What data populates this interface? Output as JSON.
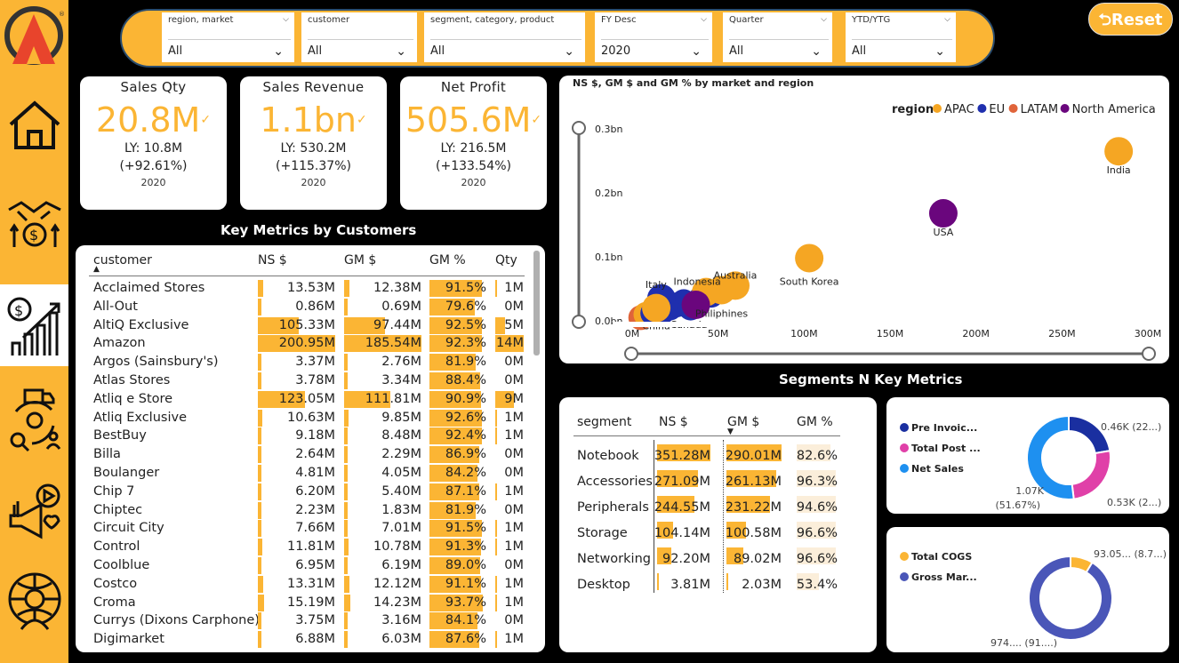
{
  "filters": [
    {
      "label": "region, market",
      "value": "All"
    },
    {
      "label": "customer",
      "value": "All"
    },
    {
      "label": "segment, category, product",
      "value": "All"
    },
    {
      "label": "FY Desc",
      "value": "2020"
    },
    {
      "label": "Quarter",
      "value": "All"
    },
    {
      "label": "YTD/YTG",
      "value": "All"
    }
  ],
  "reset_label": "Reset",
  "kpis": [
    {
      "title": "Sales Qty",
      "value": "20.8M",
      "ly": "LY: 10.8M",
      "pct": "(+92.61%)",
      "year": "2020"
    },
    {
      "title": "Sales Revenue",
      "value": "1.1bn",
      "ly": "LY: 530.2M",
      "pct": "(+115.37%)",
      "year": "2020"
    },
    {
      "title": "Net Profit",
      "value": "505.6M",
      "ly": "LY: 216.5M",
      "pct": "(+133.54%)",
      "year": "2020"
    }
  ],
  "customers_title": "Key Metrics by Customers",
  "customers_headers": {
    "customer": "customer",
    "ns": "NS $",
    "gm": "GM $",
    "gmp": "GM %",
    "qty": "Qty"
  },
  "customers": [
    {
      "name": "Acclaimed Stores",
      "ns": "13.53M",
      "gm": "12.38M",
      "gmp": "91.5%",
      "qty": "1M",
      "nsv": 13.53,
      "gmv": 12.38,
      "gmpv": 91.5,
      "qtyv": 1
    },
    {
      "name": "All-Out",
      "ns": "0.86M",
      "gm": "0.69M",
      "gmp": "79.6%",
      "qty": "0M",
      "nsv": 0.86,
      "gmv": 0.69,
      "gmpv": 79.6,
      "qtyv": 0
    },
    {
      "name": "AltiQ Exclusive",
      "ns": "105.33M",
      "gm": "97.44M",
      "gmp": "92.5%",
      "qty": "5M",
      "nsv": 105.33,
      "gmv": 97.44,
      "gmpv": 92.5,
      "qtyv": 5
    },
    {
      "name": "Amazon",
      "ns": "200.95M",
      "gm": "185.54M",
      "gmp": "92.3%",
      "qty": "14M",
      "nsv": 200.95,
      "gmv": 185.54,
      "gmpv": 92.3,
      "qtyv": 14
    },
    {
      "name": "Argos (Sainsbury's)",
      "ns": "3.37M",
      "gm": "2.76M",
      "gmp": "81.9%",
      "qty": "0M",
      "nsv": 3.37,
      "gmv": 2.76,
      "gmpv": 81.9,
      "qtyv": 0
    },
    {
      "name": "Atlas Stores",
      "ns": "3.78M",
      "gm": "3.34M",
      "gmp": "88.4%",
      "qty": "0M",
      "nsv": 3.78,
      "gmv": 3.34,
      "gmpv": 88.4,
      "qtyv": 0
    },
    {
      "name": "Atliq e Store",
      "ns": "123.05M",
      "gm": "111.81M",
      "gmp": "90.9%",
      "qty": "9M",
      "nsv": 123.05,
      "gmv": 111.81,
      "gmpv": 90.9,
      "qtyv": 9
    },
    {
      "name": "Atliq Exclusive",
      "ns": "10.63M",
      "gm": "9.85M",
      "gmp": "92.6%",
      "qty": "1M",
      "nsv": 10.63,
      "gmv": 9.85,
      "gmpv": 92.6,
      "qtyv": 1
    },
    {
      "name": "BestBuy",
      "ns": "9.18M",
      "gm": "8.48M",
      "gmp": "92.4%",
      "qty": "1M",
      "nsv": 9.18,
      "gmv": 8.48,
      "gmpv": 92.4,
      "qtyv": 1
    },
    {
      "name": "Billa",
      "ns": "2.64M",
      "gm": "2.29M",
      "gmp": "86.9%",
      "qty": "0M",
      "nsv": 2.64,
      "gmv": 2.29,
      "gmpv": 86.9,
      "qtyv": 0
    },
    {
      "name": "Boulanger",
      "ns": "4.81M",
      "gm": "4.05M",
      "gmp": "84.2%",
      "qty": "0M",
      "nsv": 4.81,
      "gmv": 4.05,
      "gmpv": 84.2,
      "qtyv": 0
    },
    {
      "name": "Chip 7",
      "ns": "6.20M",
      "gm": "5.40M",
      "gmp": "87.1%",
      "qty": "1M",
      "nsv": 6.2,
      "gmv": 5.4,
      "gmpv": 87.1,
      "qtyv": 1
    },
    {
      "name": "Chiptec",
      "ns": "2.23M",
      "gm": "1.83M",
      "gmp": "81.9%",
      "qty": "0M",
      "nsv": 2.23,
      "gmv": 1.83,
      "gmpv": 81.9,
      "qtyv": 0
    },
    {
      "name": "Circuit City",
      "ns": "7.66M",
      "gm": "7.01M",
      "gmp": "91.5%",
      "qty": "1M",
      "nsv": 7.66,
      "gmv": 7.01,
      "gmpv": 91.5,
      "qtyv": 1
    },
    {
      "name": "Control",
      "ns": "11.81M",
      "gm": "10.78M",
      "gmp": "91.3%",
      "qty": "1M",
      "nsv": 11.81,
      "gmv": 10.78,
      "gmpv": 91.3,
      "qtyv": 1
    },
    {
      "name": "Coolblue",
      "ns": "6.95M",
      "gm": "6.19M",
      "gmp": "89.0%",
      "qty": "0M",
      "nsv": 6.95,
      "gmv": 6.19,
      "gmpv": 89.0,
      "qtyv": 0
    },
    {
      "name": "Costco",
      "ns": "13.31M",
      "gm": "12.12M",
      "gmp": "91.1%",
      "qty": "1M",
      "nsv": 13.31,
      "gmv": 12.12,
      "gmpv": 91.1,
      "qtyv": 1
    },
    {
      "name": "Croma",
      "ns": "15.19M",
      "gm": "14.23M",
      "gmp": "93.7%",
      "qty": "1M",
      "nsv": 15.19,
      "gmv": 14.23,
      "gmpv": 93.7,
      "qtyv": 1
    },
    {
      "name": "Currys (Dixons Carphone)",
      "ns": "3.75M",
      "gm": "3.16M",
      "gmp": "84.1%",
      "qty": "0M",
      "nsv": 3.75,
      "gmv": 3.16,
      "gmpv": 84.1,
      "qtyv": 0
    },
    {
      "name": "Digimarket",
      "ns": "6.88M",
      "gm": "6.03M",
      "gmp": "87.6%",
      "qty": "1M",
      "nsv": 6.88,
      "gmv": 6.03,
      "gmpv": 87.6,
      "qtyv": 1
    }
  ],
  "scatter_title": "NS $, GM $ and GM % by market and region",
  "scatter_legend_title": "region",
  "chart_data": {
    "type": "scatter",
    "title": "NS $, GM $ and GM % by market and region",
    "xlim": [
      0,
      300
    ],
    "ylim": [
      0,
      0.3
    ],
    "x_ticks": [
      "0M",
      "50M",
      "100M",
      "150M",
      "200M",
      "250M",
      "300M"
    ],
    "y_ticks": [
      "0.0bn",
      "0.1bn",
      "0.2bn",
      "0.3bn"
    ],
    "legend": [
      {
        "name": "APAC",
        "color": "#f5a623"
      },
      {
        "name": "EU",
        "color": "#1f2fae"
      },
      {
        "name": "LATAM",
        "color": "#e0643a"
      },
      {
        "name": "North America",
        "color": "#6a067d"
      }
    ],
    "points": [
      {
        "label": "India",
        "x": 283,
        "y": 0.265,
        "region": "APAC"
      },
      {
        "label": "USA",
        "x": 181,
        "y": 0.168,
        "region": "North America"
      },
      {
        "label": "South Korea",
        "x": 103,
        "y": 0.098,
        "region": "APAC"
      },
      {
        "label": "Australia",
        "x": 60,
        "y": 0.055,
        "region": "APAC"
      },
      {
        "label": "Philiphines",
        "x": 52,
        "y": 0.048,
        "region": "APAC"
      },
      {
        "label": "Indonesia",
        "x": 43,
        "y": 0.045,
        "region": "APAC"
      },
      {
        "label": "Canada",
        "x": 37,
        "y": 0.025,
        "region": "North America"
      },
      {
        "label": "Italy",
        "x": 17,
        "y": 0.035,
        "region": "EU"
      },
      {
        "label": "China",
        "x": 14,
        "y": 0.02,
        "region": "APAC"
      }
    ]
  },
  "segments_title": "Segments N Key Metrics",
  "segments_headers": {
    "segment": "segment",
    "ns": "NS $",
    "gm": "GM $",
    "gmp": "GM %"
  },
  "segments": [
    {
      "name": "Notebook",
      "ns": "351.28M",
      "gm": "290.01M",
      "gmp": "82.6%",
      "nsv": 351.28,
      "gmv": 290.01,
      "gmpv": 82.6
    },
    {
      "name": "Accessories",
      "ns": "271.09M",
      "gm": "261.13M",
      "gmp": "96.3%",
      "nsv": 271.09,
      "gmv": 261.13,
      "gmpv": 96.3
    },
    {
      "name": "Peripherals",
      "ns": "244.55M",
      "gm": "231.22M",
      "gmp": "94.6%",
      "nsv": 244.55,
      "gmv": 231.22,
      "gmpv": 94.6
    },
    {
      "name": "Storage",
      "ns": "104.14M",
      "gm": "100.58M",
      "gmp": "96.6%",
      "nsv": 104.14,
      "gmv": 100.58,
      "gmpv": 96.6
    },
    {
      "name": "Networking",
      "ns": "92.20M",
      "gm": "89.02M",
      "gmp": "96.6%",
      "nsv": 92.2,
      "gmv": 89.02,
      "gmpv": 96.6
    },
    {
      "name": "Desktop",
      "ns": "3.81M",
      "gm": "2.03M",
      "gmp": "53.4%",
      "nsv": 3.81,
      "gmv": 2.03,
      "gmpv": 53.4
    }
  ],
  "donut1": {
    "legend": [
      {
        "name": "Pre Invoic...",
        "color": "#1a2fa0"
      },
      {
        "name": "Total Post ...",
        "color": "#e040a8"
      },
      {
        "name": "Net Sales",
        "color": "#1e90f0"
      }
    ],
    "slices": [
      {
        "value": 0.46,
        "color": "#1a2fa0"
      },
      {
        "value": 0.53,
        "color": "#e040a8"
      },
      {
        "value": 1.07,
        "color": "#1e90f0"
      }
    ],
    "labels": [
      "0.46K (22...)",
      "0.53K (2...)",
      "1.07K",
      "(51.67%)"
    ]
  },
  "donut2": {
    "legend": [
      {
        "name": "Total COGS",
        "color": "#fbb534"
      },
      {
        "name": "Gross Mar...",
        "color": "#4a56b8"
      }
    ],
    "slices": [
      {
        "value": 93.05,
        "color": "#fbb534"
      },
      {
        "value": 974,
        "color": "#4a56b8"
      }
    ],
    "labels": [
      "93.05... (8.7...)",
      "974.... (91....)"
    ]
  },
  "colors": {
    "accent": "#fbb534",
    "bar_light": "#fbeeda"
  }
}
